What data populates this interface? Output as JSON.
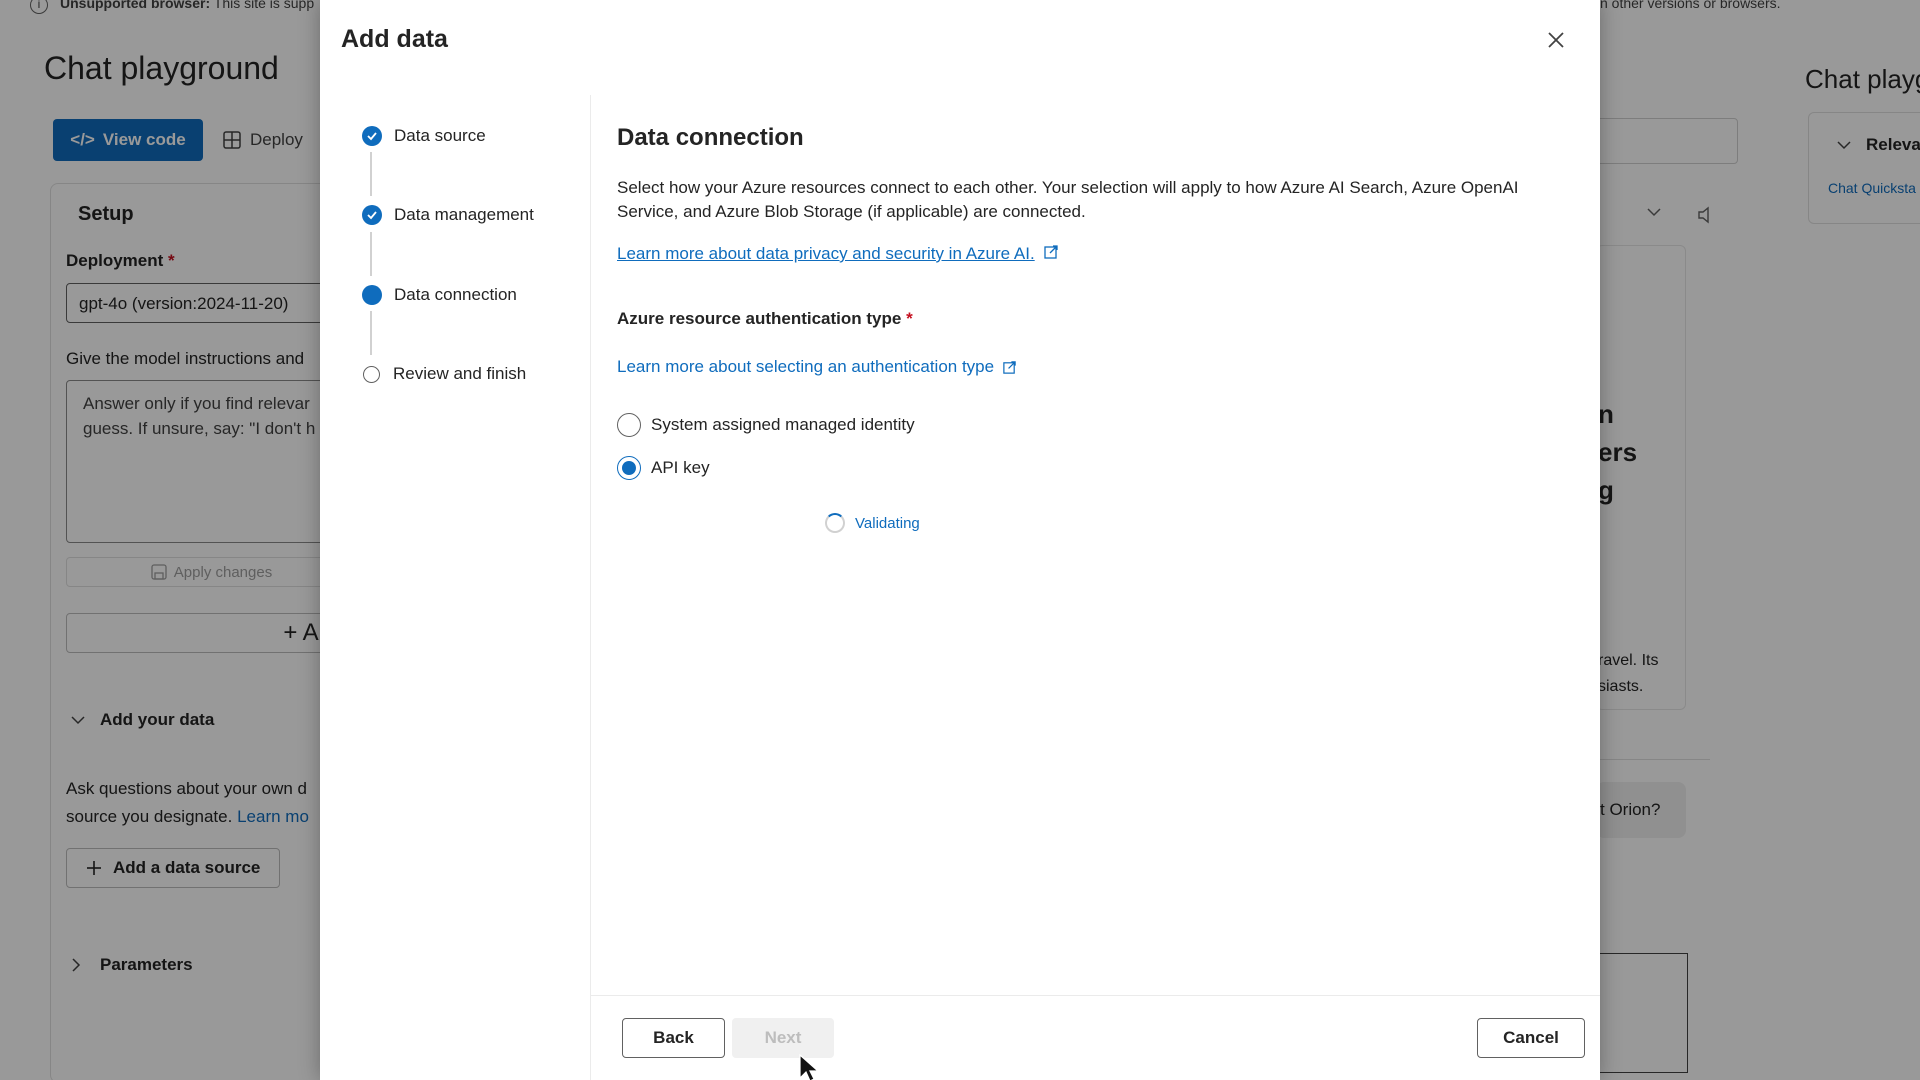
{
  "background": {
    "banner_bold": "Unsupported browser:",
    "banner_text": " This site is supp",
    "banner_right": "n other versions or browsers.",
    "page_title": "Chat playground",
    "view_code": "View code",
    "deploy": "Deploy",
    "setup": "Setup",
    "deployment_label": "Deployment",
    "deployment_value": "gpt-4o (version:2024-11-20)",
    "instructions_label": "Give the model instructions and",
    "instructions_text": "Answer only if you find relevar\nguess. If unsure, say: \"I don't h",
    "apply_changes": "Apply changes",
    "add_plus": "+ A",
    "add_your_data": "Add your data",
    "ask_line1": "Ask questions about your own d",
    "ask_line2": "source you designate.",
    "learn_more": "Learn mo",
    "add_data_source": "Add a data source",
    "parameters": "Parameters",
    "right_title": "Chat playg",
    "relevant": "Relevar",
    "chat_quickstart": "Chat Quicksta",
    "mid_text1": "n\ners\ng",
    "mid_text2": "ravel. Its\nsiasts.",
    "orion": "t Orion?"
  },
  "dialog": {
    "title": "Add data",
    "steps": [
      {
        "label": "Data source",
        "state": "done"
      },
      {
        "label": "Data management",
        "state": "done"
      },
      {
        "label": "Data connection",
        "state": "current"
      },
      {
        "label": "Review and finish",
        "state": "todo"
      }
    ],
    "content": {
      "title": "Data connection",
      "description": "Select how your Azure resources connect to each other. Your selection will apply to how Azure AI Search, Azure OpenAI Service, and Azure Blob Storage (if applicable) are connected.",
      "privacy_link": "Learn more about data privacy and security in Azure AI.",
      "auth_label": "Azure resource authentication type",
      "auth_link": "Learn more about selecting an authentication type",
      "options": [
        {
          "label": "System assigned managed identity",
          "checked": false
        },
        {
          "label": "API key",
          "checked": true
        }
      ],
      "validating": "Validating"
    },
    "footer": {
      "back": "Back",
      "next": "Next",
      "cancel": "Cancel"
    }
  },
  "colors": {
    "accent": "#0f6cbd",
    "required": "#c50f1f"
  }
}
